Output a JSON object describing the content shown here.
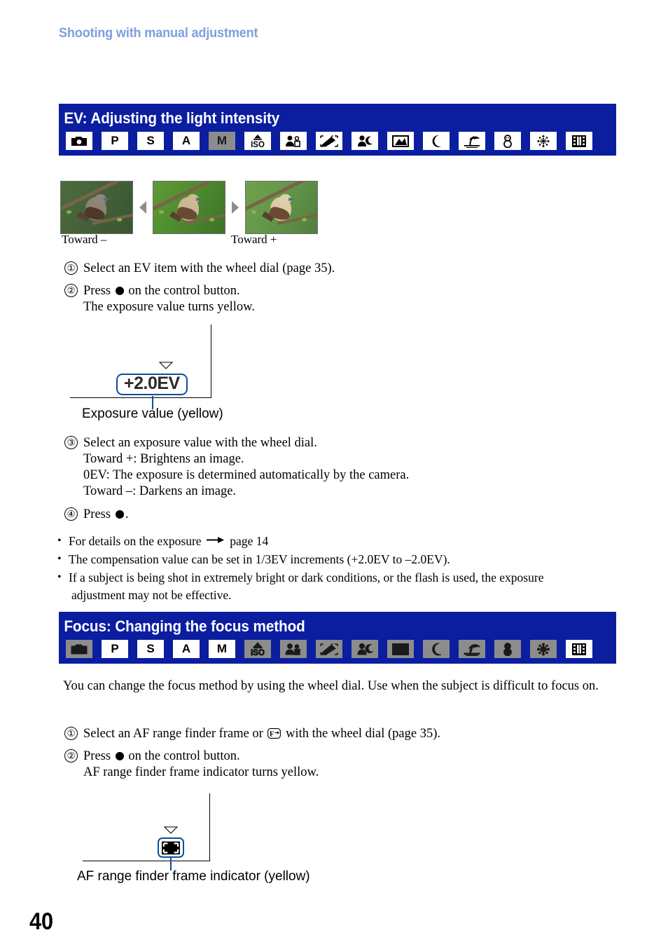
{
  "running_head": "Shooting with manual adjustment",
  "page_number": "40",
  "colors": {
    "banner_blue": "#0b1ea0",
    "running_head_blue": "#7f9ede",
    "callout_blue": "#0b4f9e",
    "icon_dim_gray": "#8c8c8c"
  },
  "sections": [
    {
      "id": "ev",
      "title": "EV: Adjusting the light intensity",
      "mode_icons": [
        {
          "name": "camera-icon",
          "label": "",
          "state": "active"
        },
        {
          "name": "program-mode-icon",
          "label": "P",
          "state": "active"
        },
        {
          "name": "shutter-mode-icon",
          "label": "S",
          "state": "active"
        },
        {
          "name": "aperture-mode-icon",
          "label": "A",
          "state": "active"
        },
        {
          "name": "manual-mode-icon",
          "label": "M",
          "state": "selected"
        },
        {
          "name": "iso-icon",
          "label": "ISO",
          "state": "active"
        },
        {
          "name": "soft-snap-icon",
          "label": "",
          "state": "active"
        },
        {
          "name": "high-sensitivity-icon",
          "label": "",
          "state": "active"
        },
        {
          "name": "twilight-portrait-icon",
          "label": "",
          "state": "active"
        },
        {
          "name": "landscape-icon",
          "label": "",
          "state": "active"
        },
        {
          "name": "twilight-icon",
          "label": "",
          "state": "active"
        },
        {
          "name": "beach-icon",
          "label": "",
          "state": "active"
        },
        {
          "name": "snow-icon",
          "label": "",
          "state": "active"
        },
        {
          "name": "fireworks-icon",
          "label": "",
          "state": "active"
        },
        {
          "name": "movie-icon",
          "label": "",
          "state": "active"
        }
      ]
    },
    {
      "id": "focus",
      "title": "Focus: Changing the focus method",
      "mode_icons": [
        {
          "name": "camera-icon",
          "label": "",
          "state": "dim"
        },
        {
          "name": "program-mode-icon",
          "label": "P",
          "state": "active"
        },
        {
          "name": "shutter-mode-icon",
          "label": "S",
          "state": "active"
        },
        {
          "name": "aperture-mode-icon",
          "label": "A",
          "state": "active"
        },
        {
          "name": "manual-mode-icon",
          "label": "M",
          "state": "active"
        },
        {
          "name": "iso-icon",
          "label": "ISO",
          "state": "dim"
        },
        {
          "name": "soft-snap-icon",
          "label": "",
          "state": "dim"
        },
        {
          "name": "high-sensitivity-icon",
          "label": "",
          "state": "dim"
        },
        {
          "name": "twilight-portrait-icon",
          "label": "",
          "state": "dim"
        },
        {
          "name": "landscape-icon",
          "label": "",
          "state": "dim"
        },
        {
          "name": "twilight-icon",
          "label": "",
          "state": "dim"
        },
        {
          "name": "beach-icon",
          "label": "",
          "state": "dim"
        },
        {
          "name": "snow-icon",
          "label": "",
          "state": "dim"
        },
        {
          "name": "fireworks-icon",
          "label": "",
          "state": "dim"
        },
        {
          "name": "movie-icon",
          "label": "",
          "state": "active"
        }
      ]
    }
  ],
  "samples": {
    "caption_minus": "Toward –",
    "caption_plus": "Toward +"
  },
  "ev_steps": {
    "s1": {
      "num": "①",
      "line1": "Select an EV item with the wheel dial (page 35)."
    },
    "s2": {
      "num": "②",
      "line1_a": "Press",
      "line1_b": "on the control button.",
      "line2": "The exposure value turns yellow."
    },
    "s3": {
      "num": "③",
      "line1": "Select an exposure value with the wheel dial.",
      "line2": "Toward +: Brightens an image.",
      "line3": "0EV: The exposure is determined automatically by the camera.",
      "line4": "Toward –: Darkens an image."
    },
    "s4": {
      "num": "④",
      "line1_a": "Press",
      "line1_b": "."
    }
  },
  "ev_callout": {
    "value": "+2.0EV",
    "label": "Exposure value (yellow)"
  },
  "ev_bullets": [
    {
      "text_a": "For details on the exposure",
      "arrow": "→",
      "text_b": "page 14"
    },
    {
      "text_a": "The compensation value can be set in 1/3EV increments (+2.0EV to –2.0EV).",
      "arrow": "",
      "text_b": ""
    },
    {
      "text_a": "If a subject is being shot in extremely bright or dark conditions, or the flash is used, the exposure",
      "arrow": "",
      "text_b": "adjustment may not be effective."
    }
  ],
  "focus_intro": {
    "line1": "You can change the focus method by using the wheel dial. Use when the subject is difficult to",
    "line2": "focus on."
  },
  "focus_steps": {
    "s1": {
      "num": "①",
      "line1_a": "Select an AF range finder frame or",
      "line1_b": "with the wheel dial (page 35)."
    },
    "s2": {
      "num": "②",
      "line1_a": "Press",
      "line1_b": "on the control button.",
      "line2": "AF range finder frame indicator turns yellow."
    }
  },
  "focus_callout": {
    "label": "AF range finder frame indicator (yellow)"
  }
}
